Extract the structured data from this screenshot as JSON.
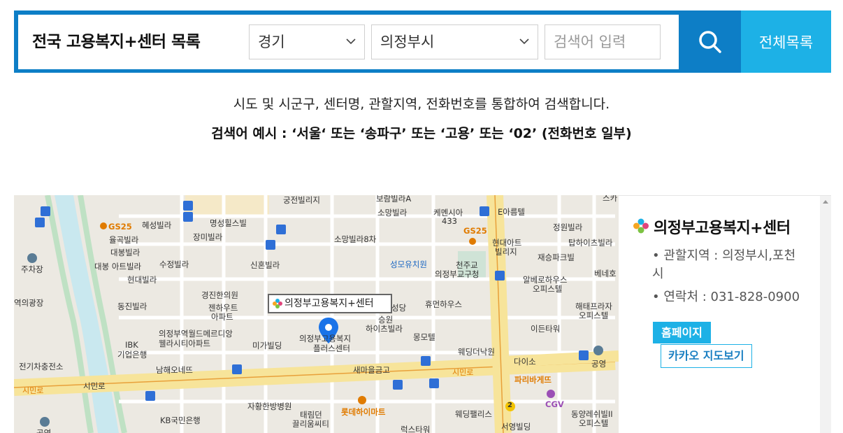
{
  "search": {
    "title": "전국 고용복지+센터 목록",
    "province": "경기",
    "city": "의정부시",
    "placeholder": "검색어 입력",
    "all_list_label": "전체목록",
    "accent": "#0d7ec6",
    "accent_light": "#1db1e6"
  },
  "help": {
    "line1": "시도 및 시군구, 센터명, 관할지역, 전화번호를 통합하여 검색합니다.",
    "line2": "검색어 예시 : ‘서울‘ 또는 ‘송파구’ 또는 ‘고용’ 또는 ‘02’ (전화번호 일부)"
  },
  "map": {
    "tooltip": "의정부고용복지+센터",
    "labels": {
      "gungjeon": "궁전빌리지",
      "borim": "보람빌라A",
      "somang": "소망빌라",
      "kemeshia": "케멘시아",
      "kemeshia_no": "433",
      "e_areum": "E아름텔",
      "gs25_a": "GS25",
      "hyeseong": "혜성빌라",
      "myeongseong": "명성힐스빌",
      "yulgok": "율곡빌라",
      "jangmi": "장미빌라",
      "daebong": "대봉빌라",
      "daebong_apt": "대봉 아트빌라",
      "sujeong": "수정빌라",
      "hyundai_villa": "현대빌라",
      "sinhon": "신혼빌라",
      "somang8": "소망빌라8차",
      "seongmo": "성모유치원",
      "gs25_b": "GS25",
      "hyundai_art": "현대아트",
      "villige": "빌리지",
      "cheonju": "천주교",
      "uijeongbu_church": "의정부교구청",
      "jeongwon": "정원빌라",
      "tamha": "탑하이츠빌라",
      "jaeseung": "재승파크빌",
      "bene": "베네호",
      "gyeongjin": "경진한의원",
      "jenhaut": "젠하우트",
      "jenhaut_apt": "아파트",
      "dongjin": "동진빌라",
      "albero": "알베로하우스",
      "albero_office": "오피스텔",
      "human": "휴먼하우스",
      "seungwon": "승원",
      "heights": "하이츠빌라",
      "seongdang": "성당",
      "haetae": "해태프라자",
      "haetae_office": "오피스텔",
      "idun": "이든타워",
      "world_medi": "의정부역월드메르디앙",
      "wellasity": "웰라시티아파트",
      "miga": "미가빌딩",
      "plus_center": "의정부고용복지",
      "plus_center2": "플러스센터",
      "mote": "몽모텔",
      "wedding": "웨딩더낙원",
      "daiso": "다이소",
      "gongyeong": "공영",
      "ibk": "IBK",
      "ibk2": "기업은행",
      "namhae": "남해오네뜨",
      "saemaeul": "새마을금고",
      "sinmin_road": "시민로",
      "sinmin_road2": "시민로",
      "sinmin_road3": "시민로",
      "paris": "파리바게뜨",
      "cgv": "CGV",
      "parking": "주차장",
      "junction": "전기차충전소",
      "wedding_palace": "웨딩팰리스",
      "dongyang": "동양레쉬빌II",
      "dongyang_office": "오피스텔",
      "jahwang": "자황한방병원",
      "taerim": "태림던",
      "kl_city": "끌리움씨티",
      "lotte": "롯데하이마트",
      "kb": "KB국민은행",
      "seoyoung": "서영빌딩",
      "ruks": "럭스타워",
      "yeui": "역의광장",
      "gong_bottom": "공영",
      "route2": "2",
      "seugi": "스카"
    }
  },
  "center": {
    "name": "의정부고용복지+센터",
    "region": "관할지역 : 의정부시,포천시",
    "phone": "연락처 : 031-828-0900",
    "home_label": "홈페이지",
    "kakao_label": "카카오 지도보기"
  }
}
